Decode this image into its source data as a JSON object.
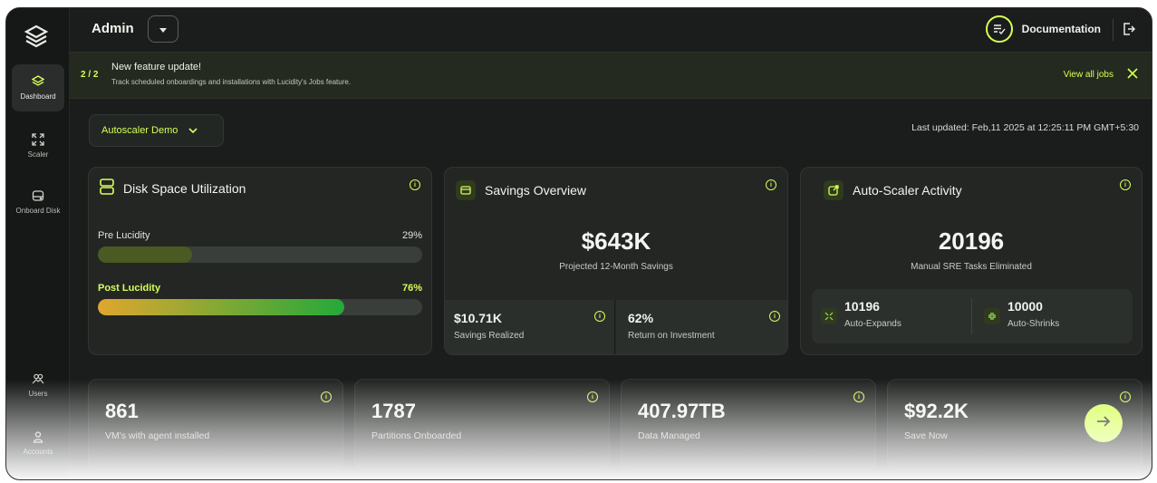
{
  "sidebar": {
    "logo": "stacked-layers-logo",
    "items": [
      {
        "label": "Dashboard",
        "icon": "layers-icon",
        "active": true
      },
      {
        "label": "Scaler",
        "icon": "expand-arrows-icon"
      },
      {
        "label": "Onboard Disk",
        "icon": "disk-icon"
      },
      {
        "label": "Users",
        "icon": "users-icon"
      },
      {
        "label": "Accounts",
        "icon": "account-icon"
      }
    ]
  },
  "header": {
    "title": "Admin",
    "documentation": "Documentation"
  },
  "banner": {
    "count": "2 / 2",
    "title": "New feature update!",
    "text": "Track scheduled onboardings and installations with Lucidity's Jobs feature.",
    "link": "View all jobs"
  },
  "selector": {
    "value": "Autoscaler Demo"
  },
  "last_updated": "Last updated: Feb,11 2025 at 12:25:11 PM GMT+5:30",
  "disk": {
    "title": "Disk Space Utilization",
    "pre_label": "Pre Lucidity",
    "pre_value": "29%",
    "pre_fraction": 0.29,
    "post_label": "Post Lucidity",
    "post_value": "76%",
    "post_fraction": 0.76
  },
  "savings": {
    "title": "Savings Overview",
    "value": "$643K",
    "subtitle": "Projected 12-Month Savings",
    "realized_value": "$10.71K",
    "realized_label": "Savings Realized",
    "roi_value": "62%",
    "roi_label": "Return on Investment"
  },
  "autoscaler": {
    "title": "Auto-Scaler Activity",
    "value": "20196",
    "subtitle": "Manual SRE Tasks Eliminated",
    "expands_value": "10196",
    "expands_label": "Auto-Expands",
    "shrinks_value": "10000",
    "shrinks_label": "Auto-Shrinks"
  },
  "stats": [
    {
      "value": "861",
      "label": "VM's with agent installed"
    },
    {
      "value": "1787",
      "label": "Partitions Onboarded"
    },
    {
      "value": "407.97TB",
      "label": "Data Managed"
    },
    {
      "value": "$92.2K",
      "label": "Save Now"
    }
  ],
  "colors": {
    "accent": "#d6ff57",
    "background": "#1b1d1c",
    "card": "#232623",
    "pre_bar": "#4b5a22",
    "post_bar_start": "#e0a72e",
    "post_bar_end": "#24a93a"
  }
}
